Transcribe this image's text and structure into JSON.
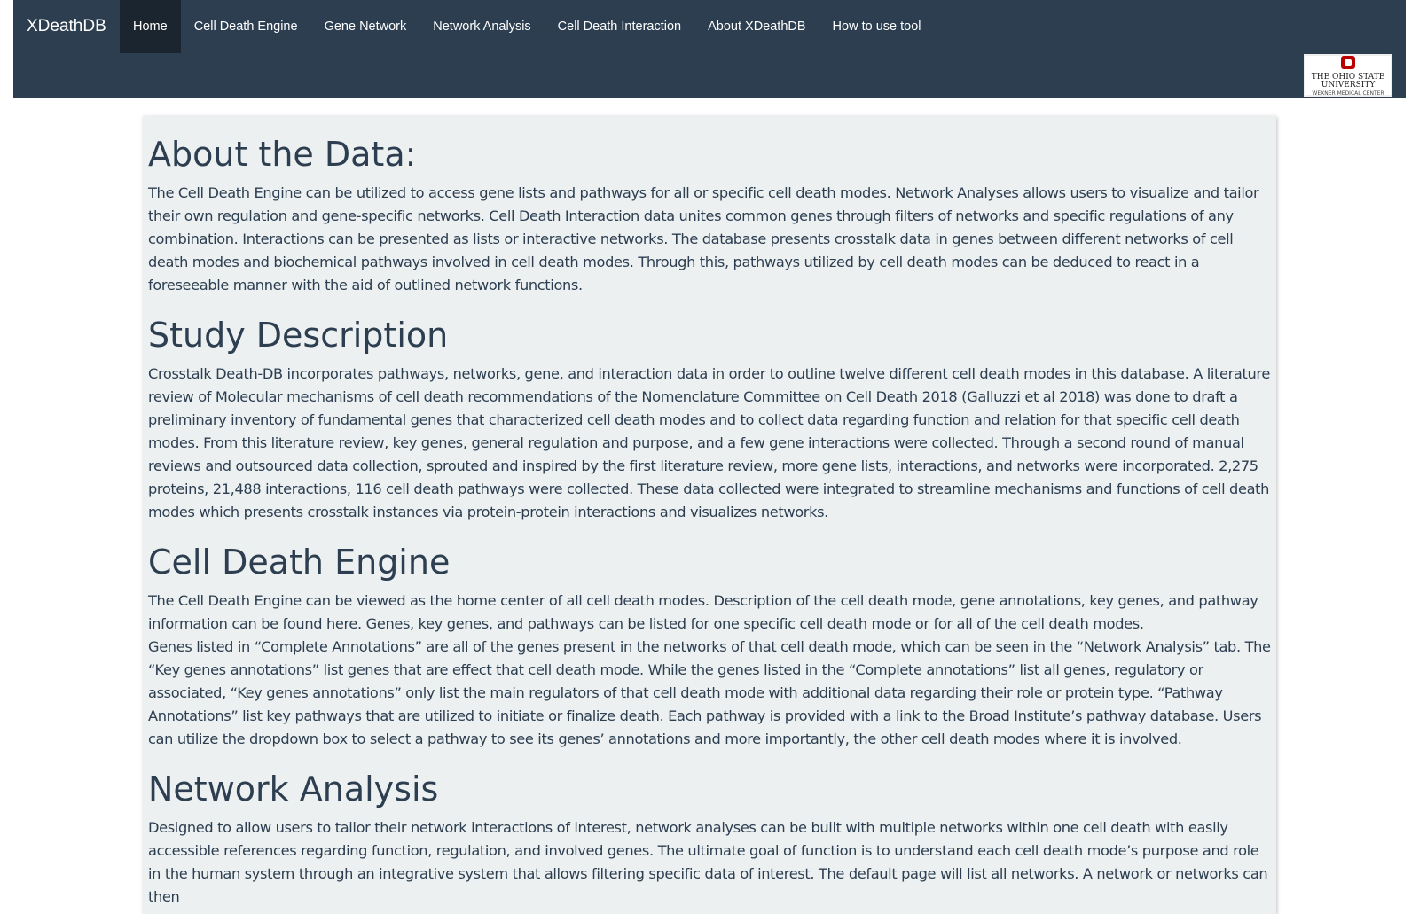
{
  "nav": {
    "brand": "XDeathDB",
    "items": [
      {
        "label": "Home",
        "active": true
      },
      {
        "label": "Cell Death Engine"
      },
      {
        "label": "Gene Network"
      },
      {
        "label": "Network Analysis"
      },
      {
        "label": "Cell Death Interaction"
      },
      {
        "label": "About XDeathDB"
      },
      {
        "label": "How to use tool"
      }
    ]
  },
  "logo": {
    "line1": "THE OHIO STATE",
    "line2": "UNIVERSITY",
    "line3": "WEXNER MEDICAL CENTER",
    "color": "#bb0000"
  },
  "sections": [
    {
      "heading": "About the Data:",
      "paragraphs": [
        "The Cell Death Engine can be utilized to access gene lists and pathways for all or specific cell death modes. Network Analyses allows users to visualize and tailor their own regulation and gene-specific networks. Cell Death Interaction data unites common genes through filters of networks and specific regulations of any combination. Interactions can be presented as lists or interactive networks. The database presents crosstalk data in genes between different networks of cell death modes and biochemical pathways involved in cell death modes. Through this, pathways utilized by cell death modes can be deduced to react in a foreseeable manner with the aid of outlined network functions."
      ]
    },
    {
      "heading": "Study Description",
      "paragraphs": [
        "Crosstalk Death-DB incorporates pathways, networks, gene, and interaction data in order to outline twelve different cell death modes in this database. A literature review of Molecular mechanisms of cell death recommendations of the Nomenclature Committee on Cell Death 2018 (Galluzzi et al 2018) was done to draft a preliminary inventory of fundamental genes that characterized cell death modes and to collect data regarding function and relation for that specific cell death modes. From this literature review, key genes, general regulation and purpose, and a few gene interactions were collected. Through a second round of manual reviews and outsourced data collection, sprouted and inspired by the first literature review, more gene lists, interactions, and networks were incorporated. 2,275 proteins, 21,488 interactions, 116 cell death pathways were collected. These data collected were integrated to streamline mechanisms and functions of cell death modes which presents crosstalk instances via protein-protein interactions and visualizes networks."
      ]
    },
    {
      "heading": "Cell Death Engine",
      "paragraphs": [
        "The Cell Death Engine can be viewed as the home center of all cell death modes. Description of the cell death mode, gene annotations, key genes, and pathway information can be found here. Genes, key genes, and pathways can be listed for one specific cell death mode or for all of the cell death modes.",
        "Genes listed in “Complete Annotations” are all of the genes present in the networks of that cell death mode, which can be seen in the “Network Analysis” tab. The “Key genes annotations” list genes that are effect that cell death mode. While the genes listed in the “Complete annotations” list all genes, regulatory or associated, “Key genes annotations” only list the main regulators of that cell death mode with additional data regarding their role or protein type. “Pathway Annotations” list key pathways that are utilized to initiate or finalize death. Each pathway is provided with a link to the Broad Institute’s pathway database. Users can utilize the dropdown box to select a pathway to see its genes’ annotations and more importantly, the other cell death modes where it is involved."
      ]
    },
    {
      "heading": "Network Analysis",
      "paragraphs": [
        "Designed to allow users to tailor their network interactions of interest, network analyses can be built with multiple networks within one cell death with easily accessible references regarding function, regulation, and involved genes. The ultimate goal of function is to understand each cell death mode’s purpose and role in the human system through an integrative system that allows filtering specific data of interest. The default page will list all networks. A network or networks can then"
      ]
    }
  ]
}
